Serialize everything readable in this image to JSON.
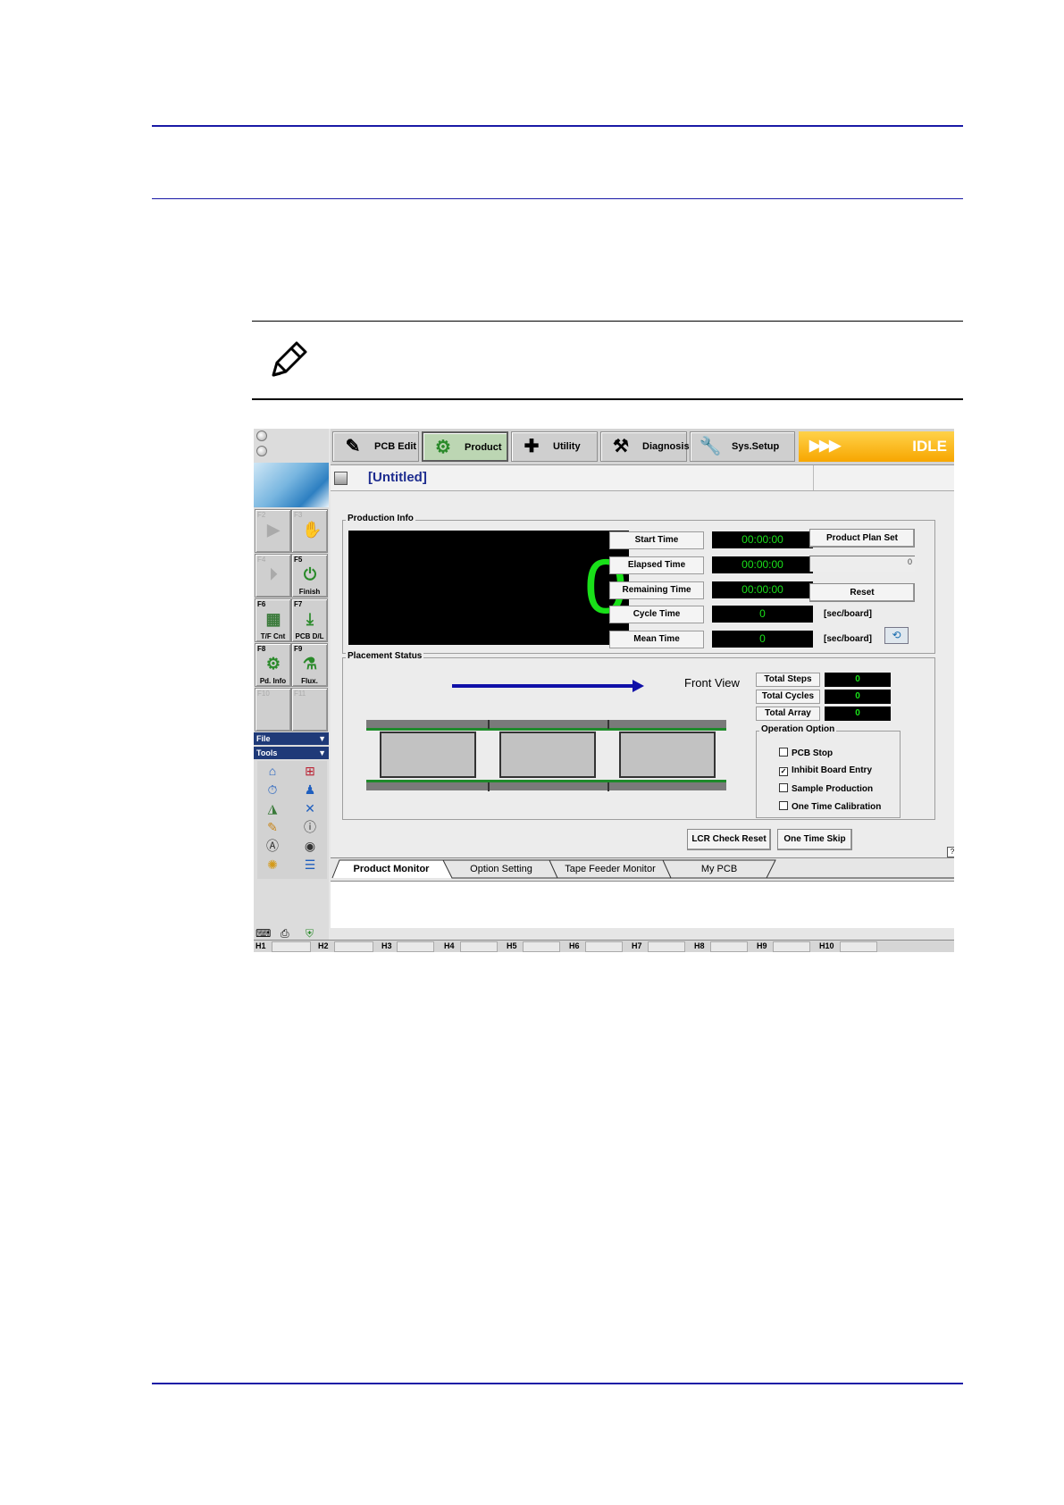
{
  "app": {
    "toolbar": [
      {
        "label": "PCB Edit",
        "icon": "pcb-edit-icon"
      },
      {
        "label": "Product",
        "icon": "product-icon",
        "active": true
      },
      {
        "label": "Utility",
        "icon": "utility-icon"
      },
      {
        "label": "Diagnosis",
        "icon": "diagnosis-icon"
      },
      {
        "label": "Sys.Setup",
        "icon": "sys-setup-icon"
      }
    ],
    "status": "IDLE",
    "doc_title": "[Untitled]",
    "fkeys": {
      "f2": "F2",
      "f3": "F3",
      "f4": "F4",
      "f5": "F5",
      "f5_label": "Finish",
      "f6": "F6",
      "f6_label": "T/F Cnt",
      "f7": "F7",
      "f7_label": "PCB D/L",
      "f8": "F8",
      "f8_label": "Pd. Info",
      "f9": "F9",
      "f9_label": "Flux.",
      "f10": "F10",
      "f11": "F11"
    },
    "menus": {
      "file": "File",
      "tools": "Tools"
    },
    "production_info": {
      "title": "Production Info",
      "big_count": "0",
      "start_time_label": "Start Time",
      "start_time": "00:00:00",
      "elapsed_time_label": "Elapsed Time",
      "elapsed_time": "00:00:00",
      "remaining_time_label": "Remaining Time",
      "remaining_time": "00:00:00",
      "cycle_time_label": "Cycle Time",
      "cycle_time": "0",
      "cycle_unit": "[sec/board]",
      "mean_time_label": "Mean Time",
      "mean_time": "0",
      "mean_unit": "[sec/board]",
      "plan_set_button": "Product Plan Set",
      "plan_value": "0",
      "reset_button": "Reset"
    },
    "placement_status": {
      "title": "Placement Status",
      "view": "Front View",
      "total_steps_label": "Total Steps",
      "total_steps": "0",
      "total_cycles_label": "Total Cycles",
      "total_cycles": "0",
      "total_array_label": "Total Array",
      "total_array": "0"
    },
    "operation_option": {
      "title": "Operation Option",
      "options": [
        {
          "label": "PCB Stop",
          "checked": false
        },
        {
          "label": "Inhibit Board Entry",
          "checked": true
        },
        {
          "label": "Sample Production",
          "checked": false
        },
        {
          "label": "One Time Calibration",
          "checked": false
        }
      ]
    },
    "actions": {
      "lcr_reset": "LCR Check Reset",
      "one_time_skip": "One Time Skip",
      "help": "?"
    },
    "tabs": [
      "Product Monitor",
      "Option Setting",
      "Tape Feeder Monitor",
      "My PCB"
    ],
    "heads": [
      "H1",
      "H2",
      "H3",
      "H4",
      "H5",
      "H6",
      "H7",
      "H8",
      "H9",
      "H10"
    ]
  },
  "colors": {
    "rule": "#1a1aa6",
    "display_green": "#19e019",
    "idle_yellow": "#f7a600"
  }
}
